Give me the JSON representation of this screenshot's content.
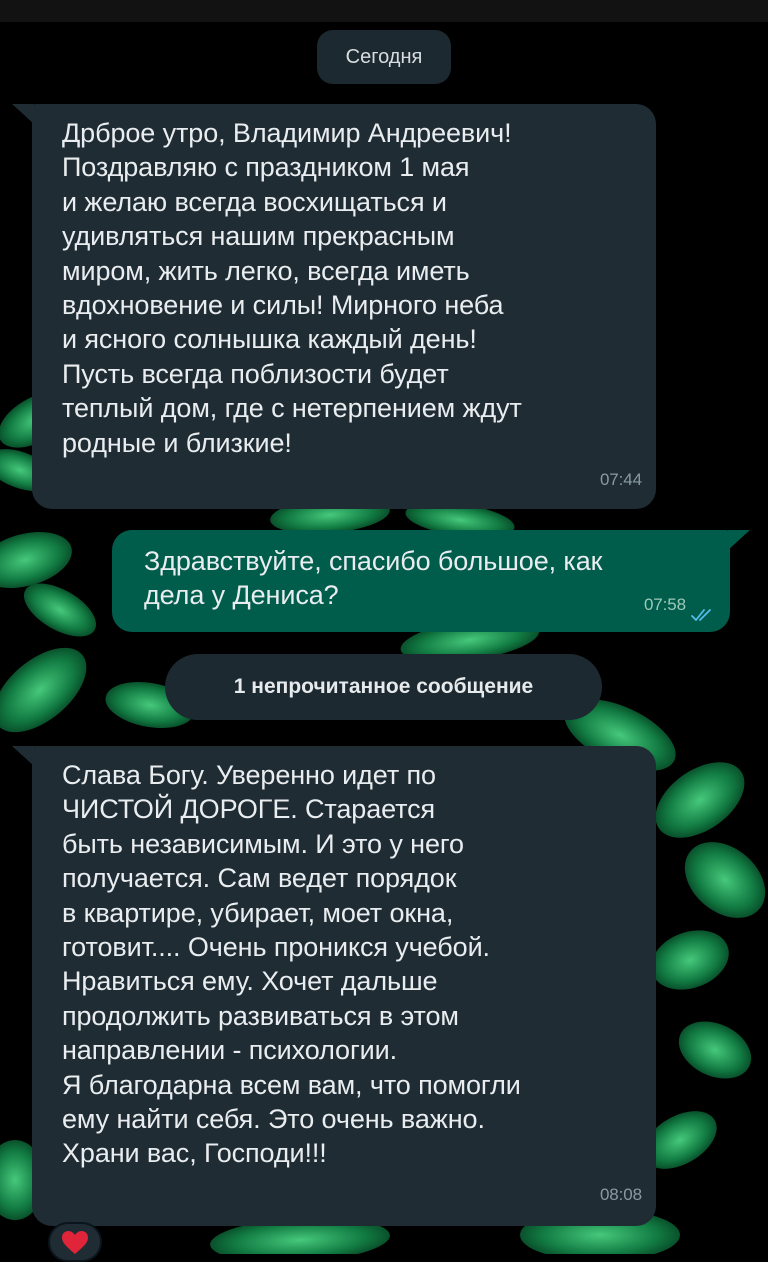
{
  "date_separator": "Сегодня",
  "unread_separator": "1 непрочитанное сообщение",
  "messages": [
    {
      "direction": "incoming",
      "text": "Дрброе утро, Владимир Андреевич!\nПоздравляю с праздником 1 мая\nи желаю всегда восхищаться и\nудивляться нашим прекрасным\nмиром, жить легко, всегда иметь\nвдохновение и силы!  Мирного неба\nи ясного солнышка каждый день!\nПусть всегда поблизости будет\nтеплый дом, где с нетерпением ждут\nродные и близкие!",
      "time": "07:44"
    },
    {
      "direction": "outgoing",
      "text": "Здравствуйте, спасибо большое, как\nдела у Дениса?",
      "time": "07:58",
      "status_icon": "double-check-read-icon"
    },
    {
      "direction": "incoming",
      "text": "Слава Богу. Уверенно идет по\nЧИСТОЙ ДОРОГЕ. Старается\nбыть независимым. И это у него\nполучается. Сам ведет порядок\nв квартире, убирает, моет окна,\nготовит.... Очень проникся учебой.\nНравиться ему. Хочет дальше\nпродолжить развиваться в этом\nнаправлении - психологии.\nЯ благодарна всем вам, что помогли\nему найти себя. Это очень  важно.\nХрани вас, Господи!!!",
      "time": "08:08",
      "reaction_icon": "red-heart-icon"
    }
  ],
  "colors": {
    "incoming_bubble": "#1f2c34",
    "outgoing_bubble": "#005c4b",
    "read_ticks": "#53bdeb",
    "leaf_green": "#1fa65a"
  }
}
